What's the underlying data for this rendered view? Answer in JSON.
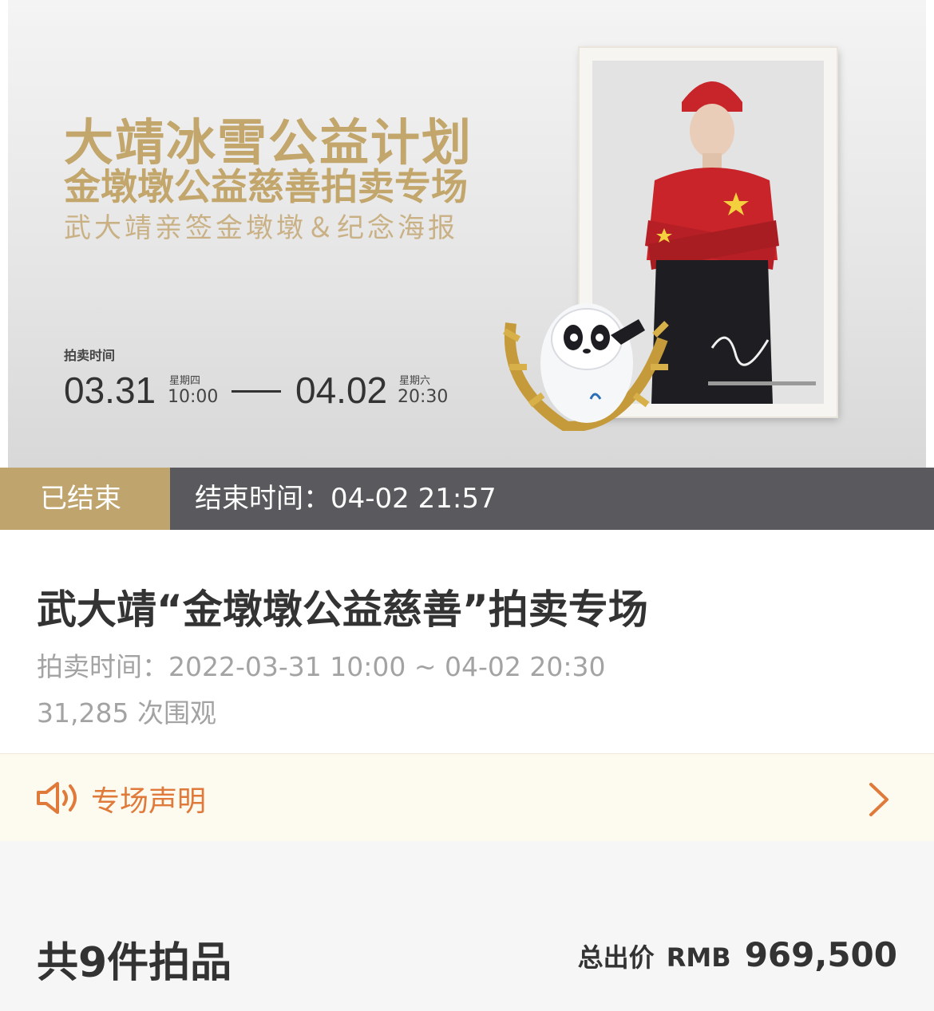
{
  "banner": {
    "title_line1": "大靖冰雪公益计划",
    "title_line2": "金墩墩公益慈善拍卖专场",
    "title_line3": "武大靖亲签金墩墩＆纪念海报",
    "time_label": "拍卖时间",
    "start_date": "03.31",
    "start_weekday": "星期四",
    "start_time": "10:00",
    "end_date": "04.02",
    "end_weekday": "星期六",
    "end_time": "20:30"
  },
  "status": {
    "tag": "已结束",
    "end_time": "结束时间：04-02 21:57"
  },
  "info": {
    "title": "武大靖“金墩墩公益慈善”拍卖专场",
    "auction_time": "拍卖时间：2022-03-31 10:00 ~ 04-02 20:30",
    "views": "31,285 次围观"
  },
  "notice": {
    "label": "专场声明",
    "icon": "speaker-icon",
    "arrow_icon": "chevron-right-icon"
  },
  "summary": {
    "count": "共9件拍品",
    "total_label": "总出价",
    "currency": "RMB",
    "total_amount": "969,500"
  },
  "colors": {
    "gold": "#c0a46e",
    "status_bar": "#5a595d",
    "notice_orange": "#e07a3b",
    "notice_bg": "#fdfaef"
  }
}
